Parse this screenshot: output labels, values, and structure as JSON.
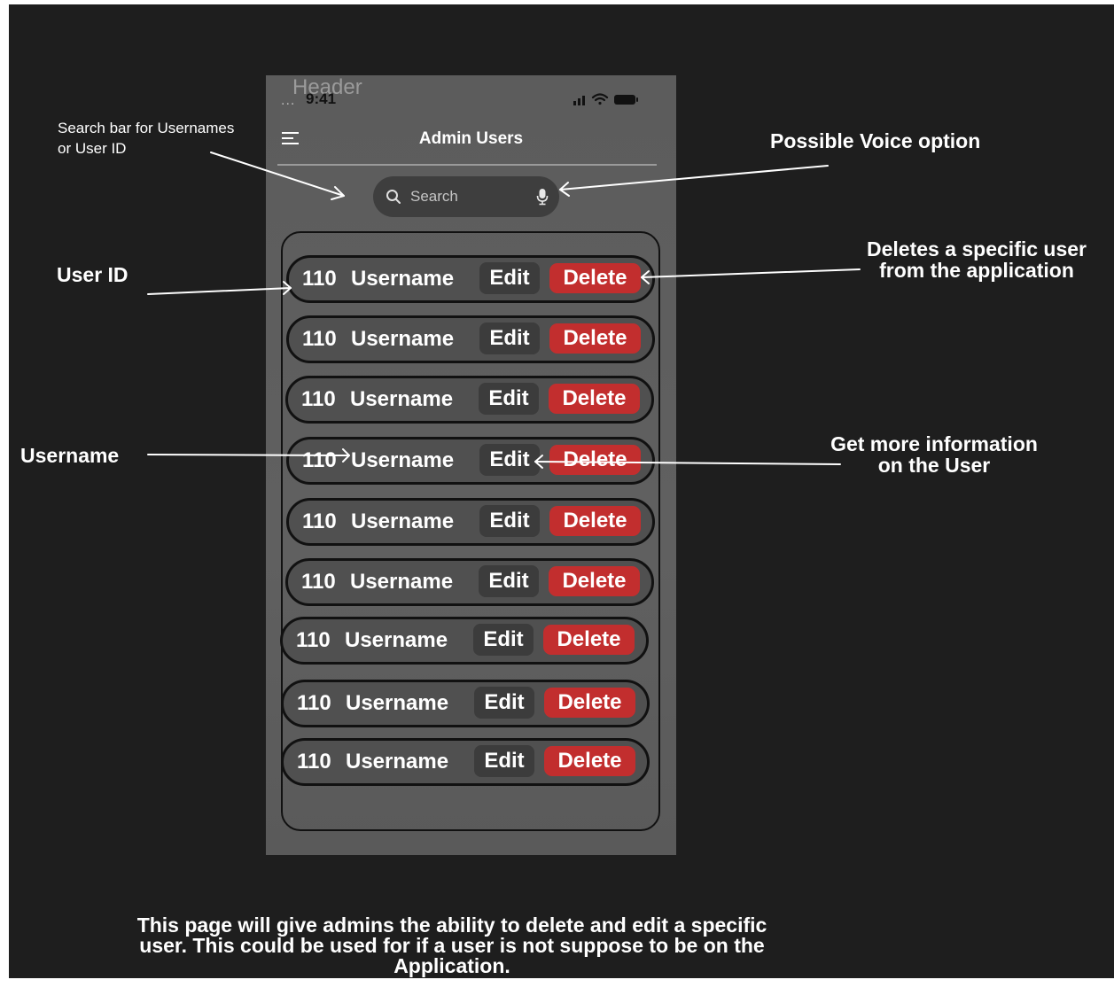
{
  "phone": {
    "header_label": "Header",
    "status_dots": "...",
    "status_time": "9:41",
    "title": "Admin Users",
    "search_placeholder": "Search"
  },
  "rows": [
    {
      "id": "110",
      "username": "Username",
      "edit_label": "Edit",
      "delete_label": "Delete"
    },
    {
      "id": "110",
      "username": "Username",
      "edit_label": "Edit",
      "delete_label": "Delete"
    },
    {
      "id": "110",
      "username": "Username",
      "edit_label": "Edit",
      "delete_label": "Delete"
    },
    {
      "id": "110",
      "username": "Username",
      "edit_label": "Edit",
      "delete_label": "Delete"
    },
    {
      "id": "110",
      "username": "Username",
      "edit_label": "Edit",
      "delete_label": "Delete"
    },
    {
      "id": "110",
      "username": "Username",
      "edit_label": "Edit",
      "delete_label": "Delete"
    },
    {
      "id": "110",
      "username": "Username",
      "edit_label": "Edit",
      "delete_label": "Delete"
    },
    {
      "id": "110",
      "username": "Username",
      "edit_label": "Edit",
      "delete_label": "Delete"
    },
    {
      "id": "110",
      "username": "Username",
      "edit_label": "Edit",
      "delete_label": "Delete"
    }
  ],
  "annotations": {
    "search_bar": [
      "Search bar for Usernames",
      "or User ID"
    ],
    "voice": "Possible Voice option",
    "user_id": "User ID",
    "delete": [
      "Deletes a specific user",
      "from the application"
    ],
    "username": "Username",
    "edit": [
      "Get more information",
      "on the User"
    ],
    "footer": [
      "This page will give admins the ability to delete and edit a specific",
      "user. This could be used for if a user is not suppose to be on the",
      "Application."
    ]
  },
  "colors": {
    "canvas": "#1e1e1e",
    "phone": "#5e5e5e",
    "delete_button": "#c22e2e",
    "edit_button": "#3c3c3c"
  }
}
